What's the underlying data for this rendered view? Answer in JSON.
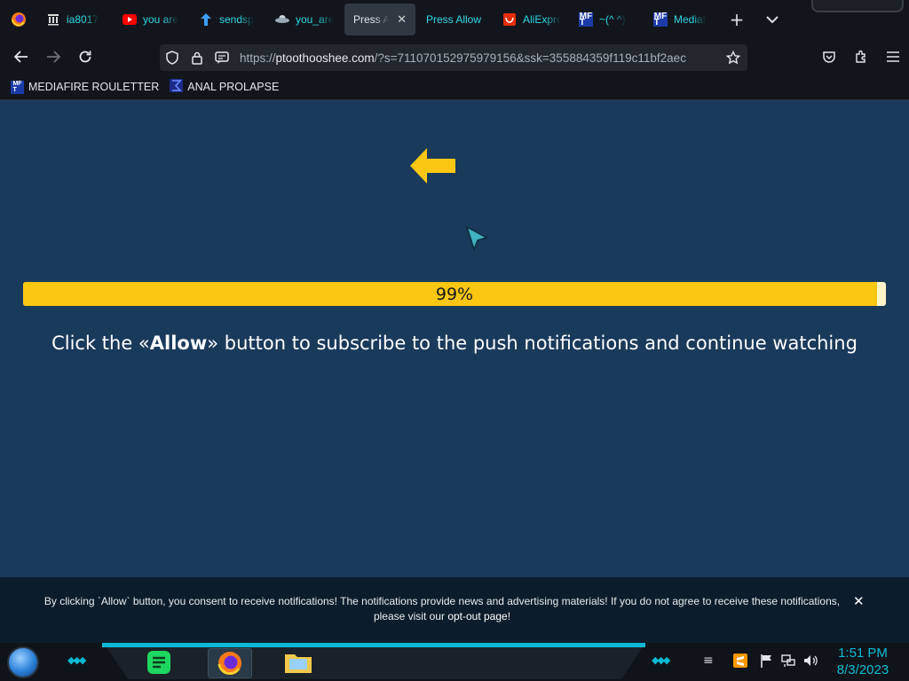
{
  "browser": {
    "tabs": [
      {
        "title": "ia8017",
        "icon": "archive-icon",
        "active": false
      },
      {
        "title": "you are",
        "icon": "youtube-icon",
        "active": false
      },
      {
        "title": "sendsp",
        "icon": "upload-icon",
        "active": false
      },
      {
        "title": "you_are",
        "icon": "ufo-icon",
        "active": false
      },
      {
        "title": "Press Allo",
        "icon": "",
        "active": true
      },
      {
        "title": "Press Allow",
        "icon": "",
        "active": false
      },
      {
        "title": "AliExpre",
        "icon": "aliexpress-icon",
        "active": false
      },
      {
        "title": "~(^ ^)",
        "icon": "mediafire-icon",
        "active": false
      },
      {
        "title": "Mediaf",
        "icon": "mediafire-icon",
        "active": false
      }
    ],
    "url": {
      "host": "ptoothooshee.com",
      "prefix": "https://",
      "rest": "/?s=711070152975979156&ssk=355884359f119c11bf2aec"
    },
    "bookmarks": [
      {
        "label": "MEDIAFIRE ROULETTER",
        "icon": "mediafire-icon"
      },
      {
        "label": "ANAL PROLAPSE",
        "icon": "sigma-icon"
      }
    ]
  },
  "page": {
    "progress": {
      "value": 0.99,
      "label": "99%"
    },
    "headline_pre": "Click the «",
    "headline_bold": "Allow",
    "headline_post": "» button to subscribe to the push notifications and continue watching"
  },
  "consent": {
    "text": "By clicking `Allow` button, you consent to receive notifications! The notifications provide news and advertising materials! If you do not agree to receive these notifications, please visit our ",
    "link": "opt-out page",
    "after": "!",
    "close": "✕"
  },
  "taskbar": {
    "time": "1:51 PM",
    "date": "8/3/2023"
  },
  "colors": {
    "page_bg": "#1a3a5c",
    "progress": "#fcc712",
    "accent": "#0ab9d4"
  }
}
